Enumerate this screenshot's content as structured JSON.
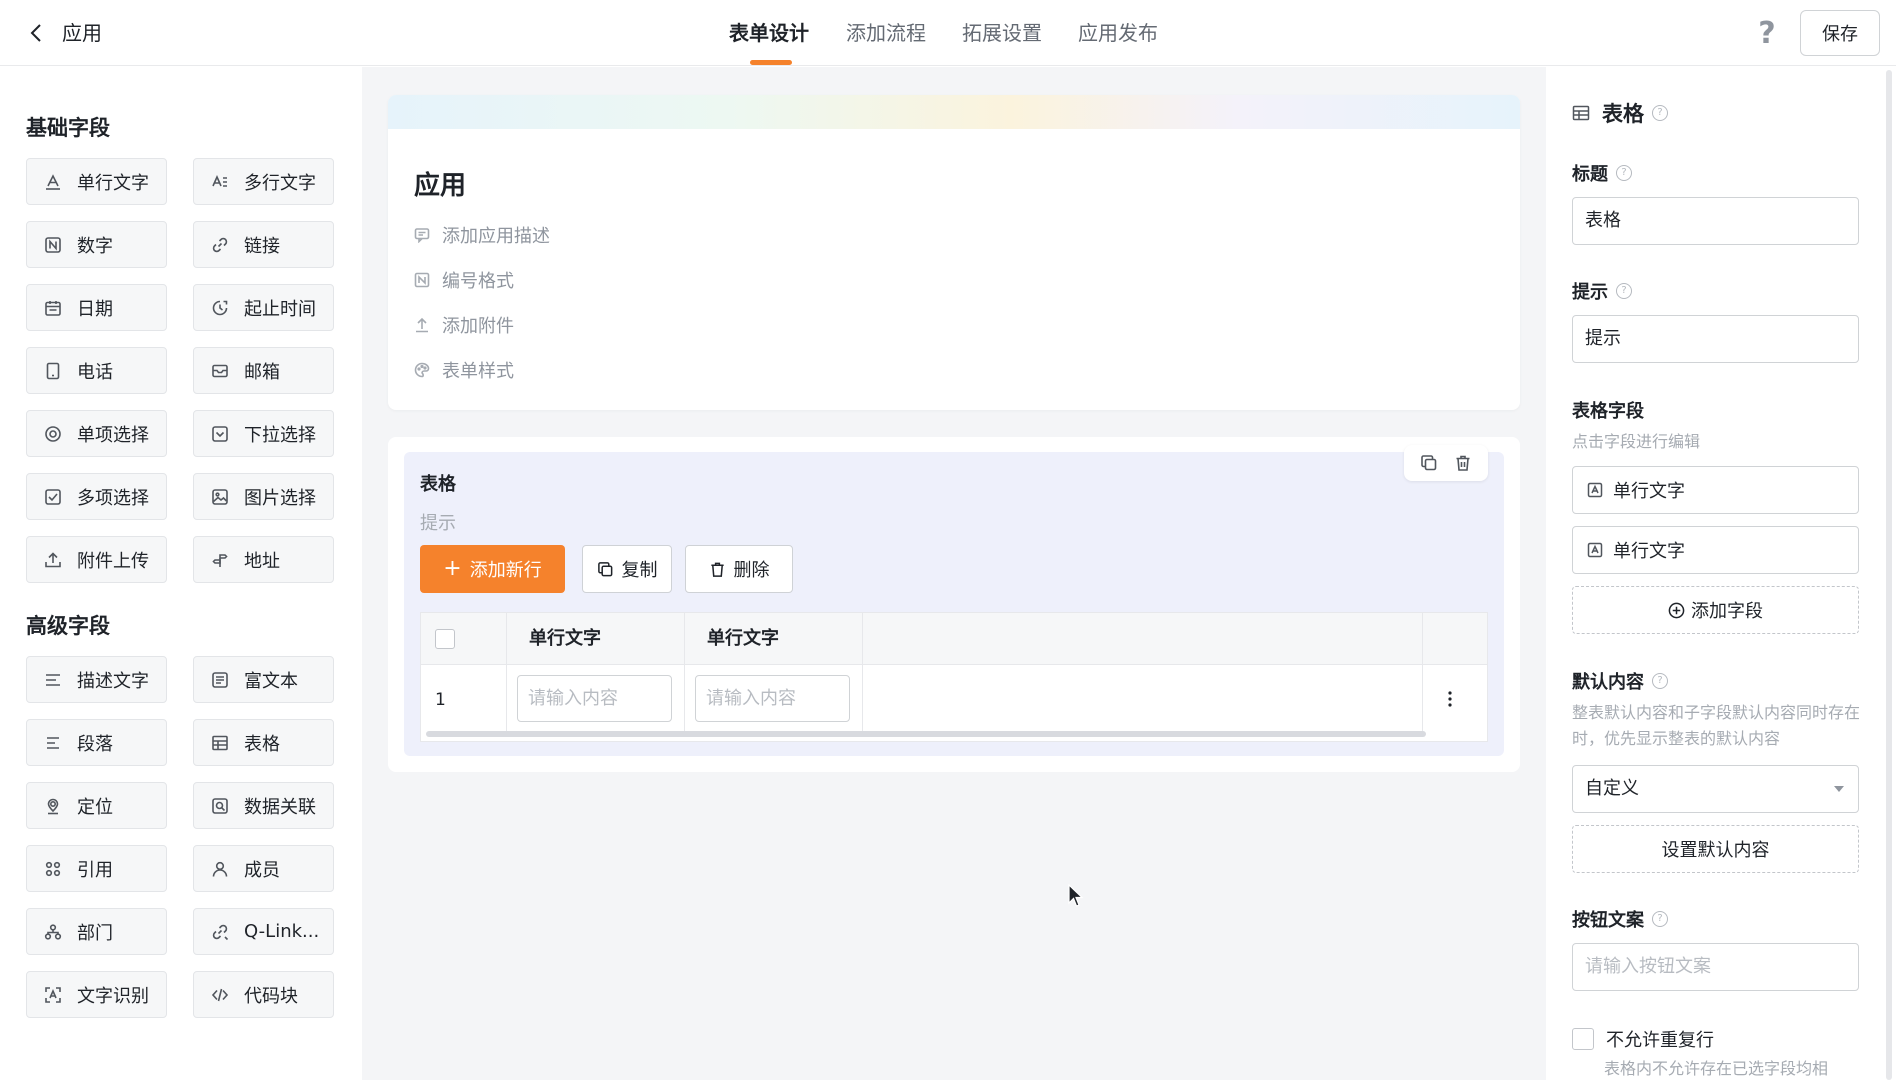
{
  "header": {
    "back_icon": "chevron-left-icon",
    "app_title": "应用",
    "tabs": [
      {
        "label": "表单设计",
        "active": true
      },
      {
        "label": "添加流程",
        "active": false
      },
      {
        "label": "拓展设置",
        "active": false
      },
      {
        "label": "应用发布",
        "active": false
      }
    ],
    "help_symbol": "?",
    "save_label": "保存",
    "accent_color": "#f5822c"
  },
  "left": {
    "basic_title": "基础字段",
    "basic_fields": [
      {
        "label": "单行文字",
        "icon": "single-line-text-icon"
      },
      {
        "label": "多行文字",
        "icon": "multi-line-text-icon"
      },
      {
        "label": "数字",
        "icon": "number-icon"
      },
      {
        "label": "链接",
        "icon": "link-icon"
      },
      {
        "label": "日期",
        "icon": "calendar-icon"
      },
      {
        "label": "起止时间",
        "icon": "time-range-icon"
      },
      {
        "label": "电话",
        "icon": "phone-icon"
      },
      {
        "label": "邮箱",
        "icon": "mail-icon"
      },
      {
        "label": "单项选择",
        "icon": "radio-icon"
      },
      {
        "label": "下拉选择",
        "icon": "dropdown-icon"
      },
      {
        "label": "多项选择",
        "icon": "checkbox-icon"
      },
      {
        "label": "图片选择",
        "icon": "image-icon"
      },
      {
        "label": "附件上传",
        "icon": "upload-icon"
      },
      {
        "label": "地址",
        "icon": "address-icon"
      }
    ],
    "advanced_title": "高级字段",
    "advanced_fields": [
      {
        "label": "描述文字",
        "icon": "description-icon"
      },
      {
        "label": "富文本",
        "icon": "rich-text-icon"
      },
      {
        "label": "段落",
        "icon": "paragraph-icon"
      },
      {
        "label": "表格",
        "icon": "table-icon"
      },
      {
        "label": "定位",
        "icon": "location-icon"
      },
      {
        "label": "数据关联",
        "icon": "data-link-icon"
      },
      {
        "label": "引用",
        "icon": "reference-icon"
      },
      {
        "label": "成员",
        "icon": "member-icon"
      },
      {
        "label": "部门",
        "icon": "department-icon"
      },
      {
        "label": "Q-Link...",
        "icon": "qlink-icon"
      },
      {
        "label": "文字识别",
        "icon": "ocr-icon"
      },
      {
        "label": "代码块",
        "icon": "code-icon"
      }
    ]
  },
  "form": {
    "title": "应用",
    "options": [
      {
        "label": "添加应用描述",
        "icon": "comment-icon"
      },
      {
        "label": "编号格式",
        "icon": "number-format-icon"
      },
      {
        "label": "添加附件",
        "icon": "upload-icon"
      },
      {
        "label": "表单样式",
        "icon": "palette-icon"
      }
    ]
  },
  "table_widget": {
    "title": "表格",
    "hint": "提示",
    "add_row": "添加新行",
    "copy": "复制",
    "delete": "删除",
    "columns": [
      "单行文字",
      "单行文字"
    ],
    "rows": [
      {
        "index": "1",
        "placeholders": [
          "请输入内容",
          "请输入内容"
        ]
      }
    ]
  },
  "right": {
    "header_title": "表格",
    "title_label": "标题",
    "title_value": "表格",
    "hint_label": "提示",
    "hint_value": "提示",
    "fields_label": "表格字段",
    "fields_sub": "点击字段进行编辑",
    "fields": [
      "单行文字",
      "单行文字"
    ],
    "add_field": "添加字段",
    "default_label": "默认内容",
    "default_sub": "整表默认内容和子字段默认内容同时存在时，优先显示整表的默认内容",
    "default_select": "自定义",
    "set_default": "设置默认内容",
    "button_text_label": "按钮文案",
    "button_text_placeholder": "请输入按钮文案",
    "no_duplicate_label": "不允许重复行",
    "no_duplicate_sub": "表格内不允许存在已选字段均相"
  }
}
